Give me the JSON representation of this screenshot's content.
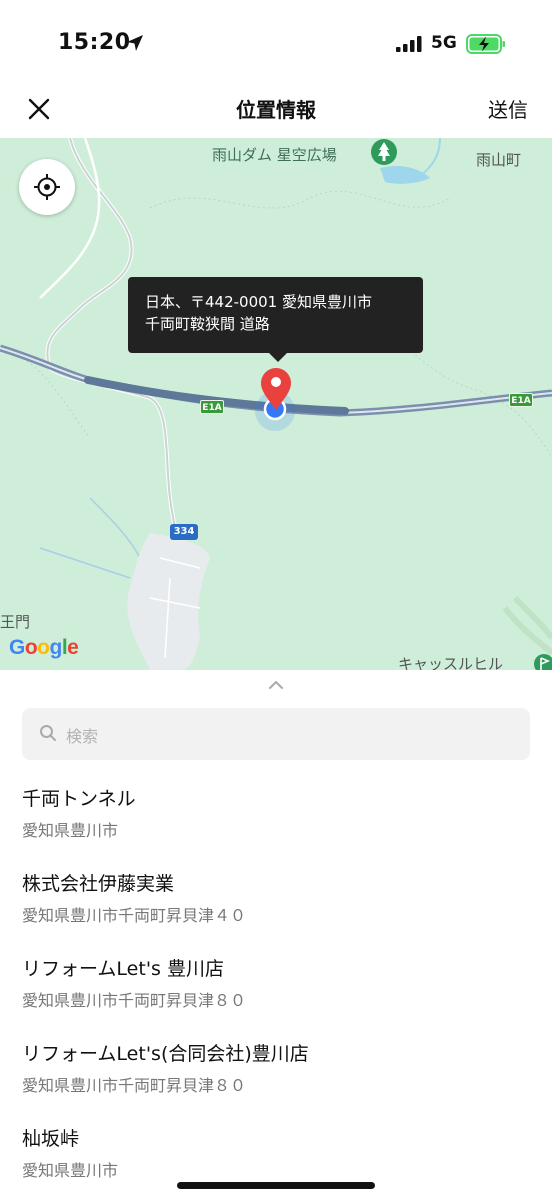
{
  "status_bar": {
    "time": "15:20",
    "network": "5G"
  },
  "header": {
    "title": "位置情報",
    "send_label": "送信"
  },
  "map": {
    "labels": {
      "dam": "雨山ダム 星空広場",
      "town": "雨山町",
      "gate": "王門",
      "castle": "キャッスルヒル"
    },
    "tooltip": {
      "line1": "日本、〒442-0001 愛知県豊川市",
      "line2": "千両町鞍狭間 道路"
    },
    "road_badges": [
      "E1A",
      "E1A"
    ],
    "route_badge": "334",
    "attribution": "Google"
  },
  "search": {
    "placeholder": "検索"
  },
  "results": [
    {
      "name": "千両トンネル",
      "address": "愛知県豊川市"
    },
    {
      "name": "株式会社伊藤実業",
      "address": "愛知県豊川市千両町昇貝津４０"
    },
    {
      "name": "リフォームLet's 豊川店",
      "address": "愛知県豊川市千両町昇貝津８０"
    },
    {
      "name": "リフォームLet's(合同会社)豊川店",
      "address": "愛知県豊川市千両町昇貝津８０"
    },
    {
      "name": "杣坂峠",
      "address": "愛知県豊川市"
    }
  ],
  "colors": {
    "map_bg": "#cfeed9",
    "pin": "#e9413d",
    "location_dot": "#3478f6",
    "highway": "#6f88a8"
  }
}
